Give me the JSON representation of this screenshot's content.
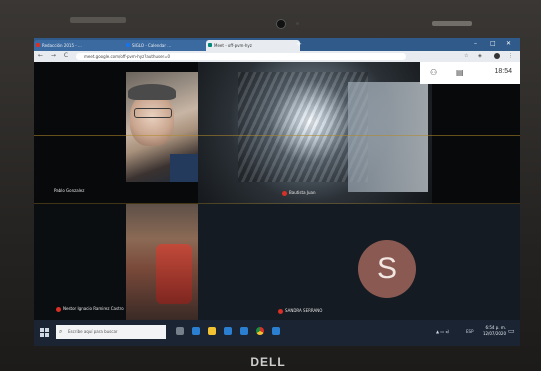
{
  "browser": {
    "tabs": [
      {
        "label": "Redacción 2015 - ...",
        "icon_color": "#d93025"
      },
      {
        "label": "SIGLO - Calendar ...",
        "icon_color": "#1a73e8"
      },
      {
        "label": "Meet - off-pvm-hyz",
        "icon_color": "#00897b"
      }
    ],
    "new_tab": "+",
    "address": "meet.google.com/off-pvm-hyz?authuser=0",
    "nav_icons": "← → C",
    "window_controls": [
      "–",
      "□",
      "✕"
    ]
  },
  "meet": {
    "clock": "18:54",
    "participants": [
      {
        "name": "Pablo Gonzalez"
      },
      {
        "name": "Bautista Juan"
      },
      {
        "name": "Nestor Ignacio Ramirez Castro"
      },
      {
        "name": "SANDRA SERRANO",
        "initial": "S"
      }
    ]
  },
  "taskbar": {
    "search_placeholder": "Escribe aquí para buscar",
    "tray_lang": "ESP",
    "time": "6:54 p. m.",
    "date": "12/07/2020"
  },
  "brand": "DELL"
}
